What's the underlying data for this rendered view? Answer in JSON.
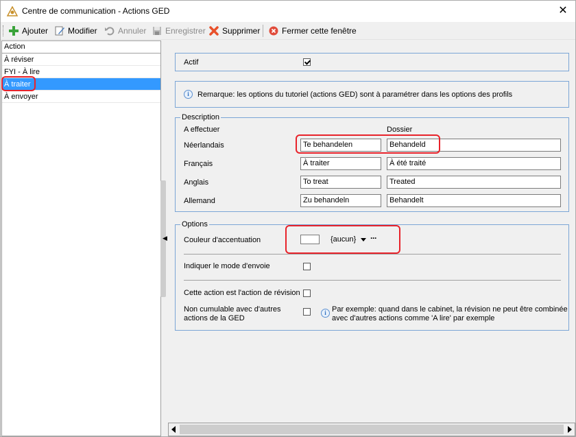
{
  "window": {
    "title": "Centre de communication - Actions GED",
    "close": "✕"
  },
  "toolbar": {
    "add": "Ajouter",
    "edit": "Modifier",
    "undo": "Annuler",
    "save": "Enregistrer",
    "delete": "Supprimer",
    "close_window": "Fermer cette fenêtre"
  },
  "list": {
    "header": "Action",
    "items": [
      "À réviser",
      "FYI - À lire",
      "À traiter",
      "À envoyer"
    ],
    "selected_index": 2
  },
  "actif": {
    "label": "Actif",
    "checked": true
  },
  "remark": {
    "text": "Remarque: les options du tutoriel (actions GED) sont à paramétrer dans les options des profils"
  },
  "description": {
    "legend": "Description",
    "col1": "A effectuer",
    "col2": "Dossier",
    "rows": [
      {
        "lang": "Néerlandais",
        "effectuer": "Te behandelen",
        "dossier": "Behandeld"
      },
      {
        "lang": "Français",
        "effectuer": "À traiter",
        "dossier": "À été traité"
      },
      {
        "lang": "Anglais",
        "effectuer": "To treat",
        "dossier": "Treated"
      },
      {
        "lang": "Allemand",
        "effectuer": "Zu behandeln",
        "dossier": "Behandelt"
      }
    ]
  },
  "options": {
    "legend": "Options",
    "accent_label": "Couleur d'accentuation",
    "accent_value": "{aucun}",
    "accent_more": "···",
    "send_mode_label": "Indiquer le mode d'envoie",
    "revision_label": "Cette action est l'action de révision",
    "non_cumul_label_1": "Non cumulable avec d'autres",
    "non_cumul_label_2": "actions de la GED",
    "example_1": "Par exemple: quand dans le cabinet, la révision ne peut être combinée",
    "example_2": "avec d'autres actions comme 'A lire' par exemple"
  },
  "colors": {
    "selection": "#3399ff",
    "groupbox_border": "#7aa5d6",
    "highlight": "#e8222a"
  }
}
